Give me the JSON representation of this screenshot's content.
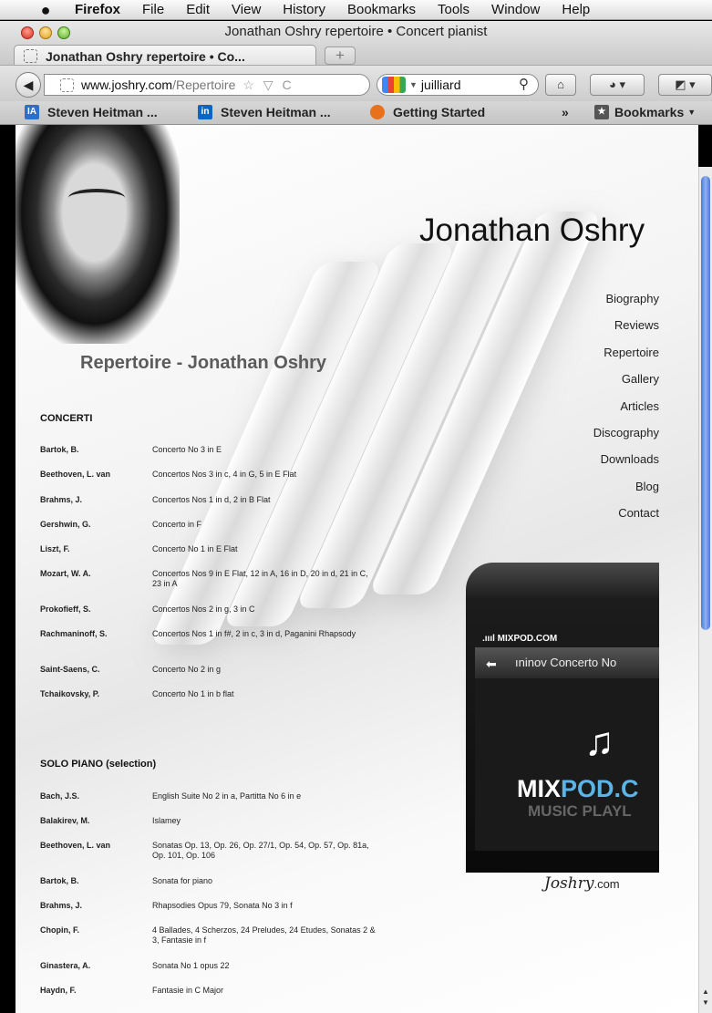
{
  "menubar": {
    "app": "Firefox",
    "items": [
      "File",
      "Edit",
      "View",
      "History",
      "Bookmarks",
      "Tools",
      "Window",
      "Help"
    ]
  },
  "window": {
    "title": "Jonathan Oshry repertoire • Concert pianist",
    "tab_label": "Jonathan Oshry repertoire • Co...",
    "new_tab": "+"
  },
  "navbar": {
    "url_host": "www.joshry.com",
    "url_path": "/Repertoire",
    "url_icons": "☆ ▽ C",
    "search_value": "juilliard"
  },
  "bookmarks": {
    "items": [
      "Steven Heitman ...",
      "Steven Heitman ...",
      "Getting Started"
    ],
    "overflow": "»",
    "menu": "Bookmarks"
  },
  "site": {
    "title": "Jonathan Oshry",
    "heading": "Repertoire - Jonathan Oshry",
    "nav": [
      "Biography",
      "Reviews",
      "Repertoire",
      "Gallery",
      "Articles",
      "Discography",
      "Downloads",
      "Blog",
      "Contact"
    ],
    "footer_logo": "Joshry",
    "footer_logo_suffix": ".com"
  },
  "concerti": {
    "title": "CONCERTI",
    "rows": [
      {
        "composer": "Bartok, B.",
        "works": "Concerto No 3 in E"
      },
      {
        "composer": "Beethoven, L. van",
        "works": "Concertos Nos 3 in c, 4 in G, 5 in E Flat"
      },
      {
        "composer": "Brahms, J.",
        "works": "Concertos Nos 1 in d, 2 in B Flat"
      },
      {
        "composer": "Gershwin, G.",
        "works": "Concerto in F"
      },
      {
        "composer": "Liszt, F.",
        "works": "Concerto No 1 in E Flat"
      },
      {
        "composer": "Mozart, W. A.",
        "works": "Concertos Nos 9 in E Flat, 12 in A, 16 in D, 20 in d, 21 in C, 23 in A"
      },
      {
        "composer": "Prokofieff, S.",
        "works": "Concertos Nos 2 in g, 3 in C"
      },
      {
        "composer": "Rachmaninoff, S.",
        "works": "Concertos Nos 1 in f#, 2 in c, 3 in d, Paganini Rhapsody"
      },
      {
        "composer": "Saint-Saens, C.",
        "works": "Concerto No 2 in g"
      },
      {
        "composer": "Tchaikovsky, P.",
        "works": "Concerto No 1 in b flat"
      }
    ]
  },
  "solo": {
    "title": "SOLO PIANO (selection)",
    "rows": [
      {
        "composer": "Bach, J.S.",
        "works": "English Suite No 2 in a, Partitta No 6 in e"
      },
      {
        "composer": "Balakirev, M.",
        "works": "Islamey"
      },
      {
        "composer": "Beethoven, L. van",
        "works": "Sonatas Op. 13, Op. 26, Op. 27/1, Op. 54, Op. 57, Op. 81a, Op. 101, Op. 106"
      },
      {
        "composer": "Bartok, B.",
        "works": "Sonata for piano"
      },
      {
        "composer": "Brahms, J.",
        "works": "Rhapsodies Opus 79, Sonata No 3 in f"
      },
      {
        "composer": "Chopin, F.",
        "works": "4 Ballades, 4 Scherzos, 24 Preludes, 24 Etudes, Sonatas 2 & 3, Fantasie in f"
      },
      {
        "composer": "Ginastera, A.",
        "works": "Sonata No 1 opus 22"
      },
      {
        "composer": "Haydn, F.",
        "works": "Fantasie in C Major"
      }
    ]
  },
  "player": {
    "status": ".ıııl MIXPOD.COM",
    "track": "ıninov Concerto No",
    "brand_a": "MIX",
    "brand_b": "POD.C",
    "subtitle": "MUSIC PLAYL"
  }
}
